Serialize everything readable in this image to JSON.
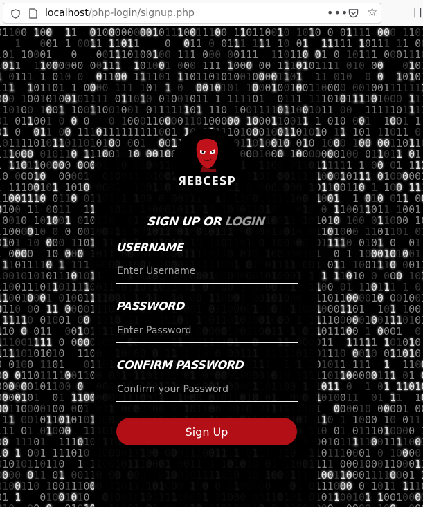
{
  "browser": {
    "url_host": "localhost",
    "url_path": "/php-login/signup.php",
    "icons": [
      "shield-icon",
      "page-icon",
      "more-icon",
      "pocket-icon",
      "star-icon",
      "library-icon"
    ]
  },
  "logo": {
    "text": "ЯEBCESP"
  },
  "form": {
    "title_prefix": "SIGN UP OR ",
    "title_link": "LOGIN",
    "username": {
      "label": "USERNAME",
      "placeholder": "Enter Username"
    },
    "password": {
      "label": "PASSWORD",
      "placeholder": "Enter Password"
    },
    "confirm": {
      "label": "CONFIRM PASSWORD",
      "placeholder": "Confirm your Password"
    },
    "submit_label": "Sign Up"
  },
  "colors": {
    "accent": "#b30f16",
    "background": "#000000",
    "link": "#9e9e9e"
  }
}
